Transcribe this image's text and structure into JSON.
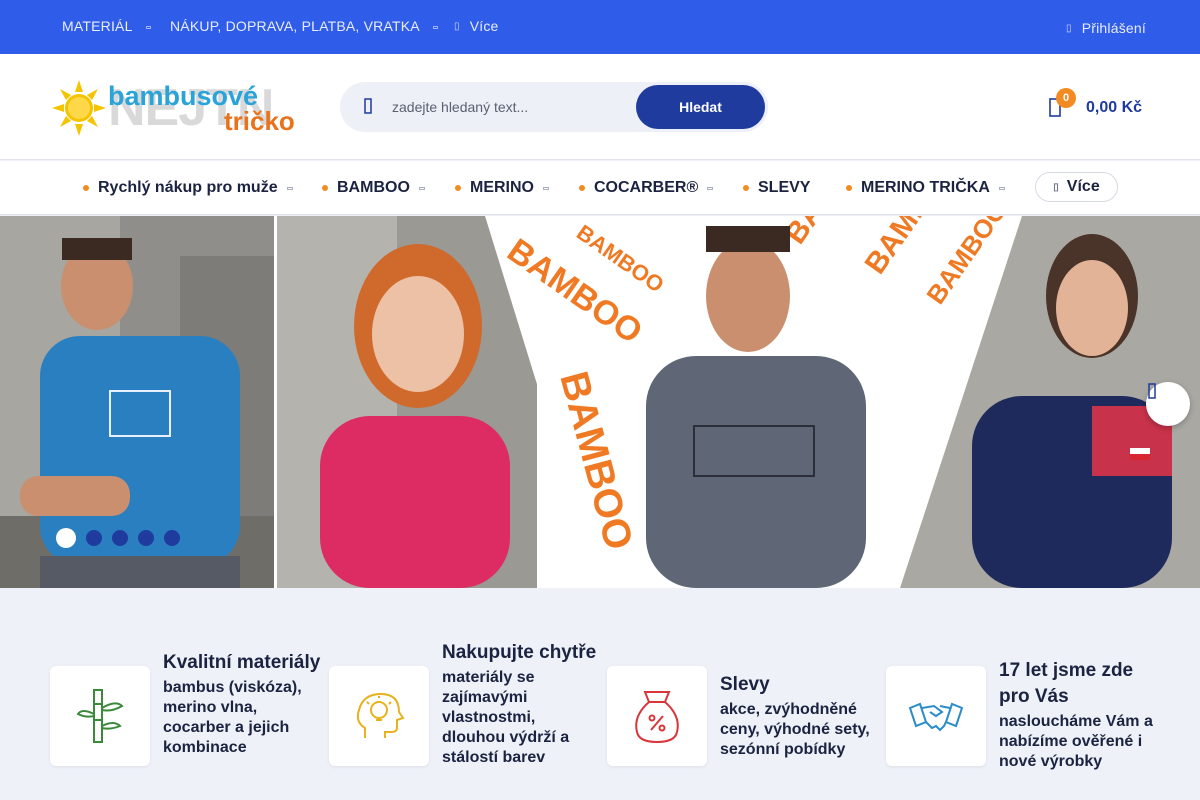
{
  "topbar": {
    "links": [
      {
        "label": "MATERIÁL"
      },
      {
        "label": "NÁKUP, DOPRAVA, PLATBA, VRATKA"
      },
      {
        "label": "Více"
      }
    ],
    "login": "Přihlášení"
  },
  "header": {
    "logo": {
      "line1": "bambusové",
      "line2": "tričko",
      "ghost": "NEJTN"
    },
    "search": {
      "placeholder": "zadejte hledaný text...",
      "button": "Hledat"
    },
    "cart": {
      "count": "0",
      "total": "0,00 Kč"
    }
  },
  "nav": {
    "items": [
      {
        "label": "Rychlý nákup pro muže"
      },
      {
        "label": "BAMBOO"
      },
      {
        "label": "MERINO"
      },
      {
        "label": "COCARBER®"
      },
      {
        "label": "SLEVY"
      },
      {
        "label": "MERINO TRIČKA"
      }
    ],
    "more": "Více"
  },
  "hero": {
    "slides_total": 5,
    "active_slide": 1,
    "banner_text": "BAMBOO",
    "icons": [
      "chevron-right-icon"
    ]
  },
  "features": [
    {
      "title": "Kvalitní materiály",
      "desc": "bambus (viskóza), merino vlna, cocarber a jejich kombinace",
      "icon": "bamboo-icon",
      "color": "#3a8a3a"
    },
    {
      "title": "Nakupujte chytře",
      "desc": "materiály se zajímavými vlastnostmi, dlouhou výdrží a stálostí barev",
      "icon": "lightbulb-head-icon",
      "color": "#e7b21e"
    },
    {
      "title": "Slevy",
      "desc": "akce, zvýhodněné ceny, výhodné sety, sezónní pobídky",
      "icon": "money-bag-percent-icon",
      "color": "#d8363b"
    },
    {
      "title": "17 let jsme zde pro Vás",
      "desc": "nasloucháme Vám a nabízíme ověřené i nové výrobky",
      "icon": "handshake-icon",
      "color": "#2a8cc8"
    }
  ],
  "colors": {
    "accent": "#2f5ce8",
    "button": "#1f3b9d",
    "badge": "#f28b22",
    "background": "#eef1f8"
  }
}
